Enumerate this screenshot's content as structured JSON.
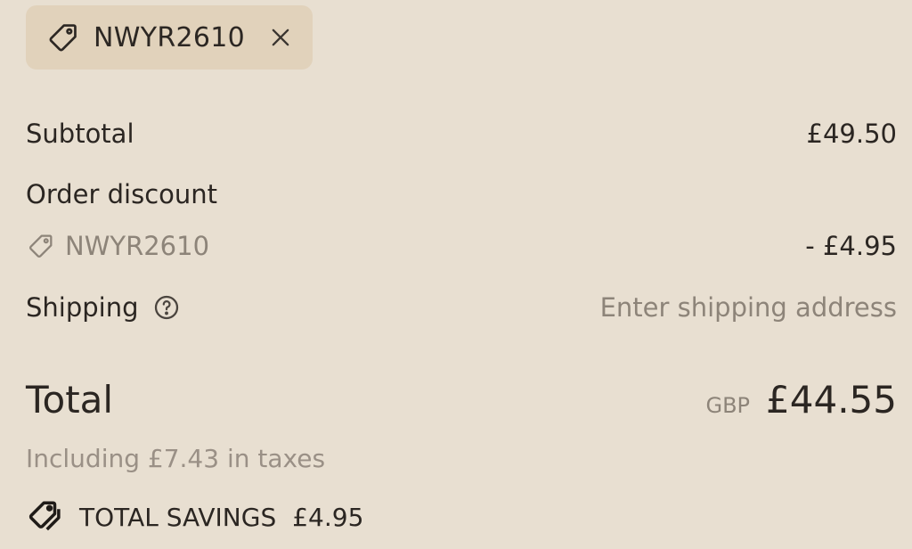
{
  "discount_chip": {
    "code": "NWYR2610",
    "icon": "tag-icon",
    "remove_icon": "close-icon"
  },
  "summary": {
    "subtotal_label": "Subtotal",
    "subtotal_value": "£49.50",
    "order_discount_label": "Order discount",
    "discount_code": "NWYR2610",
    "discount_value": "- £4.95",
    "shipping_label": "Shipping",
    "shipping_value": "Enter shipping address",
    "shipping_help_icon": "question-circle-icon",
    "total_label": "Total",
    "total_currency": "GBP",
    "total_value": "£44.55",
    "tax_note": "Including £7.43 in taxes",
    "savings_label": "TOTAL SAVINGS",
    "savings_value": "£4.95",
    "savings_icon": "tags-icon"
  },
  "colors": {
    "background": "#e8dfd1",
    "chip_background": "#e1d2bb",
    "text": "#2b2622",
    "muted_text": "#8d8479"
  }
}
